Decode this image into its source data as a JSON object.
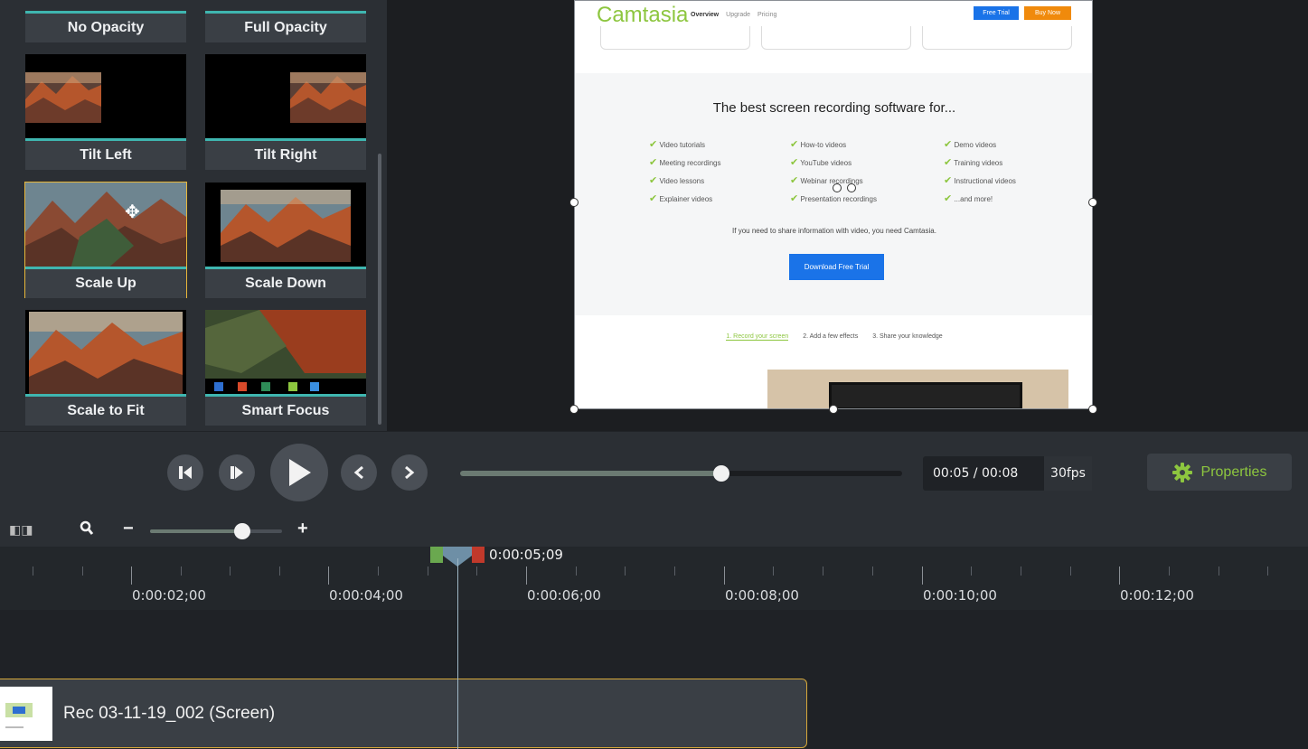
{
  "library": {
    "tiles": [
      {
        "label": "No Opacity"
      },
      {
        "label": "Full Opacity"
      },
      {
        "label": "Tilt Left"
      },
      {
        "label": "Tilt Right"
      },
      {
        "label": "Scale Up"
      },
      {
        "label": "Scale Down"
      },
      {
        "label": "Scale to Fit"
      },
      {
        "label": "Smart Focus"
      }
    ],
    "selected": "Scale Up"
  },
  "webpage": {
    "logo": "Camtasia",
    "nav": [
      "Overview",
      "Upgrade",
      "Pricing"
    ],
    "free_trial": "Free Trial",
    "buy_now": "Buy Now",
    "heading": "The best screen recording software for...",
    "features": [
      [
        "Video tutorials",
        "How-to videos",
        "Demo videos"
      ],
      [
        "Meeting recordings",
        "YouTube videos",
        "Training videos"
      ],
      [
        "Video lessons",
        "Webinar recordings",
        "Instructional videos"
      ],
      [
        "Explainer videos",
        "Presentation recordings",
        "...and more!"
      ]
    ],
    "tagline": "If you need to share information with video, you need Camtasia.",
    "download_button": "Download Free Trial",
    "steps": [
      "1. Record your screen",
      "2. Add a few effects",
      "3. Share your knowledge"
    ]
  },
  "transport": {
    "time": "00:05 / 00:08",
    "fps": "30fps",
    "progress": 0.59,
    "properties_label": "Properties"
  },
  "zoom": {
    "minus": "−",
    "plus": "+",
    "level": 0.7
  },
  "timeline": {
    "playhead_time": "0:00:05;09",
    "ruler_labels": [
      "0:00:02;00",
      "0:00:04;00",
      "0:00:06;00",
      "0:00:08;00",
      "0:00:10;00",
      "0:00:12;00"
    ],
    "clip_name": "Rec 03-11-19_002 (Screen)"
  },
  "colors": {
    "accent_green": "#8dc63f",
    "teal": "#3fb6b0",
    "selected_gold": "#e8b73a"
  }
}
